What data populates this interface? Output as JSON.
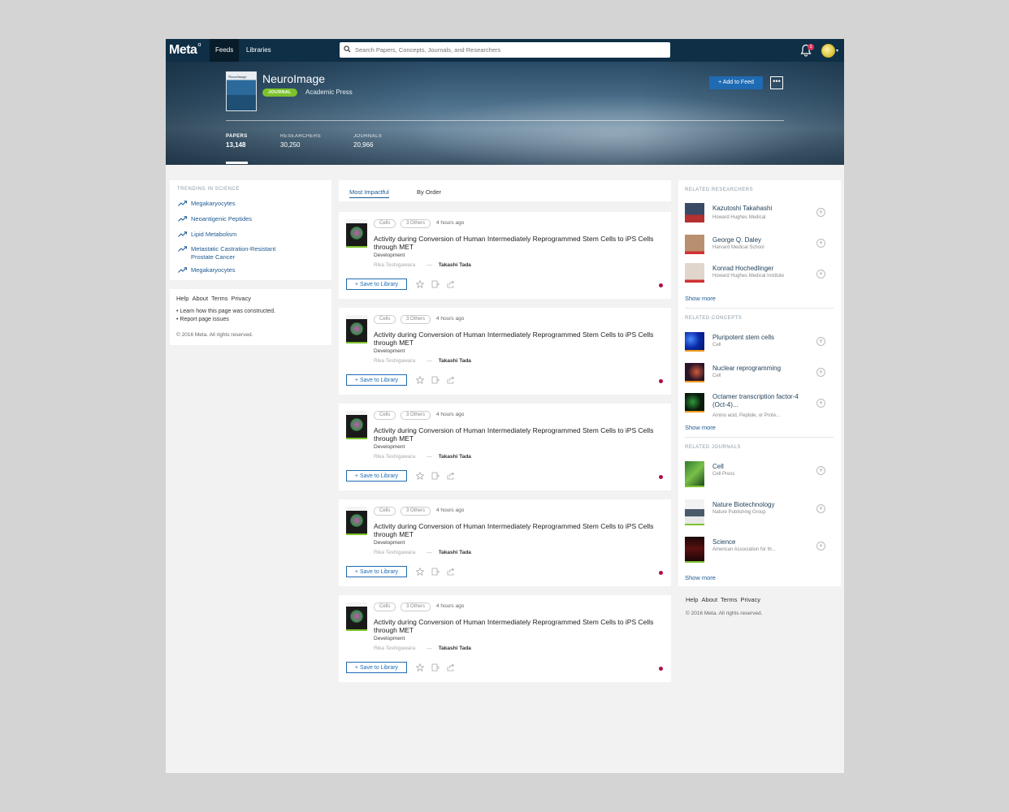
{
  "nav": {
    "logo": "Meta",
    "logo_sup": "α",
    "tabs": [
      "Feeds",
      "Libraries"
    ],
    "search_placeholder": "Search Papers, Concepts, Journals, and Researchers",
    "notification_count": "3"
  },
  "header": {
    "cover_title": "NeuroImage",
    "title": "NeuroImage",
    "badge": "JOURNAL",
    "publisher": "Academic Press",
    "add_feed": "Add to Feed",
    "more": "•••",
    "stats": [
      {
        "label": "PAPERS",
        "value": "13,148"
      },
      {
        "label": "RESEARCHERS",
        "value": "30,250"
      },
      {
        "label": "JOURNALS",
        "value": "20,966"
      }
    ]
  },
  "trending": {
    "heading": "TRENDING IN SCIENCE",
    "items": [
      "Megakaryocytes",
      "Neoantigenic Peptides",
      "Lipid Metabolism",
      "Metastatic Castration-Resistant Prostate Cancer",
      "Megakaryocytes"
    ]
  },
  "footer_left": {
    "links": [
      "Help",
      "About",
      "Terms",
      "Privacy"
    ],
    "notes": [
      "• Learn how this page was constructed.",
      "• Report page issues"
    ],
    "copyright": "© 2016 Meta. All rights reserved."
  },
  "feed": {
    "tabs": [
      "Most Impactful",
      "By Order"
    ],
    "papers": [
      {
        "tag": "Cells",
        "others": "3 Others",
        "time": "4 hours ago",
        "title": "Activity during Conversion of Human Intermediately Reprogrammed Stem Cells to iPS Cells through MET",
        "journal": "Development",
        "author1": "Rika Teshigawara",
        "author2": "Takashi Tada",
        "save": "Save to Library"
      },
      {
        "tag": "Cells",
        "others": "3 Others",
        "time": "4 hours ago",
        "title": "Activity during Conversion of Human Intermediately Reprogrammed Stem Cells to iPS Cells through MET",
        "journal": "Development",
        "author1": "Rika Teshigawara",
        "author2": "Takashi Tada",
        "save": "Save to Library"
      },
      {
        "tag": "Cells",
        "others": "3 Others",
        "time": "4 hours ago",
        "title": "Activity during Conversion of Human Intermediately Reprogrammed Stem Cells to iPS Cells through MET",
        "journal": "Development",
        "author1": "Rika Teshigawara",
        "author2": "Takashi Tada",
        "save": "Save to Library"
      },
      {
        "tag": "Cells",
        "others": "3 Others",
        "time": "4 hours ago",
        "title": "Activity during Conversion of Human Intermediately Reprogrammed Stem Cells to iPS Cells through MET",
        "journal": "Development",
        "author1": "Rika Teshigawara",
        "author2": "Takashi Tada",
        "save": "Save to Library"
      },
      {
        "tag": "Cells",
        "others": "3 Others",
        "time": "4 hours ago",
        "title": "Activity during Conversion of Human Intermediately Reprogrammed Stem Cells to iPS Cells through MET",
        "journal": "Development",
        "author1": "Rika Teshigawara",
        "author2": "Takashi Tada",
        "save": "Save to Library"
      }
    ]
  },
  "related": {
    "researchers_heading": "RELATED RESEARCHERS",
    "researchers": [
      {
        "name": "Kazutoshi Takahashi",
        "sub": "Howard Hughes Medical"
      },
      {
        "name": "George Q. Daley",
        "sub": "Harvard Medical School"
      },
      {
        "name": "Konrad Hochedlinger",
        "sub": "Howard Hughes Medical Institute"
      }
    ],
    "concepts_heading": "RELATED CONCEPTS",
    "concepts": [
      {
        "name": "Pluripotent stem cells",
        "sub": "Cell"
      },
      {
        "name": "Nuclear reprogramming",
        "sub": "Cell"
      },
      {
        "name": "Octamer transcription factor-4 (Oct-4)...",
        "sub": "Amino acid, Peptide, or Prote..."
      }
    ],
    "journals_heading": "RELATED JOURNALS",
    "journals": [
      {
        "name": "Cell",
        "sub": "Cell Press"
      },
      {
        "name": "Nature Biotechnology",
        "sub": "Nature Publishing Group"
      },
      {
        "name": "Science",
        "sub": "American Association for th..."
      }
    ],
    "show_more": "Show more"
  },
  "footer_right": {
    "links": [
      "Help",
      "About",
      "Terms",
      "Privacy"
    ],
    "copyright": "© 2016 Meta. All rights reserved."
  },
  "colors": {
    "nav_bg": "#0e2f45",
    "accent": "#1f6bb3",
    "badge_green": "#7dc12c",
    "dot_red": "#b0103c"
  }
}
